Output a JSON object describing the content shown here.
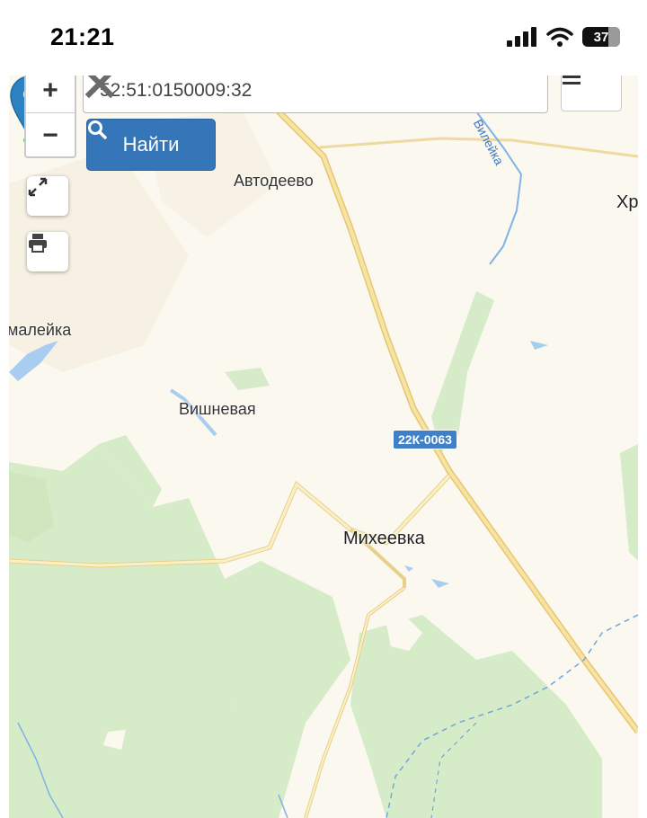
{
  "status_bar": {
    "time": "21:21",
    "battery_level": "37",
    "icons": [
      "signal-icon",
      "wifi-icon",
      "battery-icon"
    ]
  },
  "search": {
    "value": "52:51:0150009:32",
    "find_label": "Найти"
  },
  "controls": {
    "zoom_in": "+",
    "zoom_out": "−",
    "icons": [
      "fullscreen-icon",
      "print-icon",
      "menu-icon",
      "clear-icon",
      "search-icon"
    ]
  },
  "map": {
    "places": {
      "avtodeevo": "Автодеево",
      "maleyka": "малейка",
      "vishnevaya": "Вишневая",
      "mikheevka": "Михеевка",
      "khr": "Хр"
    },
    "river_label": "Вилейка",
    "road_badge": "22К-0063",
    "colors": {
      "background": "#fbf8ef",
      "forest": "#d6ebc8",
      "road": "#f2d98a",
      "water": "#7fb3e6",
      "marker": "#2d82c2",
      "button": "#3576b8"
    }
  }
}
